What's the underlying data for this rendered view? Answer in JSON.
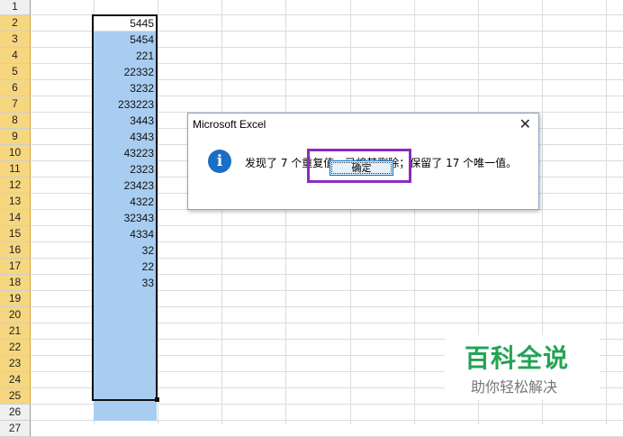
{
  "sheet": {
    "row_numbers": [
      "1",
      "2",
      "3",
      "4",
      "5",
      "6",
      "7",
      "8",
      "9",
      "10",
      "11",
      "12",
      "13",
      "14",
      "15",
      "16",
      "17",
      "18",
      "19",
      "20",
      "21",
      "22",
      "23",
      "24",
      "25",
      "26",
      "27"
    ],
    "column_b_values": [
      "5445",
      "5454",
      "221",
      "22332",
      "3232",
      "233223",
      "3443",
      "4343",
      "43223",
      "2323",
      "23423",
      "4322",
      "32343",
      "4334",
      "32",
      "22",
      "33",
      "",
      "",
      "",
      "",
      "",
      "",
      "",
      ""
    ],
    "selection_color": "#a9cdf0",
    "header_highlight_color": "#f7d680"
  },
  "dialog": {
    "title": "Microsoft Excel",
    "close_glyph": "✕",
    "info_glyph": "i",
    "message": "发现了 7 个重复值，已将其删除；保留了 17 个唯一值。",
    "ok_label": "确定",
    "highlight_color": "#8a2bbf"
  },
  "watermark": {
    "main": "百科全说",
    "sub": "助你轻松解决"
  }
}
